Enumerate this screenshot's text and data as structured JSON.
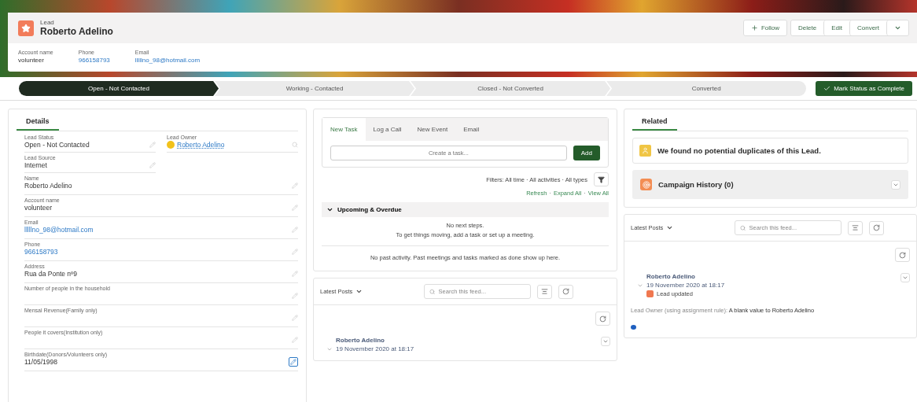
{
  "record": {
    "type_label": "Lead",
    "name": "Roberto Adelino",
    "actions": [
      {
        "kind": "follow",
        "label": "Follow"
      },
      {
        "kind": "plain",
        "label": "Delete"
      },
      {
        "kind": "plain",
        "label": "Edit"
      },
      {
        "kind": "plain",
        "label": "Convert"
      },
      {
        "kind": "menu"
      }
    ],
    "highlights": [
      {
        "label": "Account name",
        "value": "volunteer",
        "link": false
      },
      {
        "label": "Phone",
        "value": "966158793",
        "link": true
      },
      {
        "label": "Email",
        "value": "lllllno_98@hotmail.com",
        "link": true
      }
    ]
  },
  "path": {
    "steps": [
      {
        "label": "Open - Not Contacted",
        "selected": true
      },
      {
        "label": "Working - Contacted",
        "selected": false
      },
      {
        "label": "Closed - Not Converted",
        "selected": false
      },
      {
        "label": "Converted",
        "selected": false
      }
    ],
    "complete_button": "Mark Status as Complete"
  },
  "details": {
    "tab": "Details",
    "fields": [
      {
        "label": "Lead Status",
        "value": "Open - Not Contacted",
        "kind": "pair"
      },
      {
        "label": "Lead Owner",
        "value": "Roberto Adelino",
        "kind": "owner"
      },
      {
        "label": "Lead Source",
        "value": "Internet",
        "kind": "pair"
      },
      {
        "label": "Name",
        "value": "Roberto Adelino",
        "kind": "text"
      },
      {
        "label": "Account name",
        "value": "volunteer",
        "kind": "text"
      },
      {
        "label": "Email",
        "value": "lllllno_98@hotmail.com",
        "kind": "link"
      },
      {
        "label": "Phone",
        "value": "966158793",
        "kind": "link"
      },
      {
        "label": "Address",
        "value": "Rua da Ponte nº9",
        "kind": "text"
      },
      {
        "label": "Number of people in the household",
        "kind": "text"
      },
      {
        "label": "Mensal Revenue(Family only)",
        "kind": "text"
      },
      {
        "label": "People it covers(Institution only)",
        "kind": "text"
      },
      {
        "label": "Birthdate(Donors/Volunteers only)",
        "value": "11/05/1998",
        "kind": "active"
      }
    ]
  },
  "activity": {
    "tabs": [
      {
        "label": "New Task",
        "selected": true
      },
      {
        "label": "Log a Call",
        "selected": false
      },
      {
        "label": "New Event",
        "selected": false
      },
      {
        "label": "Email",
        "selected": false
      }
    ],
    "task_placeholder": "Create a task...",
    "add_button": "Add",
    "filters": "Filters: All time · All activities · All types",
    "links": [
      "Refresh",
      "Expand All",
      "View All"
    ],
    "link_separator": "·",
    "section": {
      "title": "Upcoming & Overdue",
      "expanded": true,
      "messages": [
        "No next steps.",
        "To get things moving, add a task or set up a meeting."
      ]
    },
    "past": "No past activity. Past meetings and tasks marked as done show up here."
  },
  "middle_feed": {
    "menu": "Latest Posts",
    "search_placeholder": "Search this feed...",
    "post": {
      "author": "Roberto Adelino",
      "date": "19 November 2020 at 18:17"
    }
  },
  "related": {
    "tab": "Related",
    "duplicates": "We found no potential duplicates of this Lead.",
    "campaign": "Campaign History (0)"
  },
  "right_feed": {
    "menu": "Latest Posts",
    "search_placeholder": "Search this feed...",
    "post": {
      "author": "Roberto Adelino",
      "date": "19 November 2020 at 18:17",
      "event": "Lead updated",
      "change_label": "Lead Owner (using assignment rule):",
      "change_value": "A blank value to Roberto Adelino"
    }
  }
}
